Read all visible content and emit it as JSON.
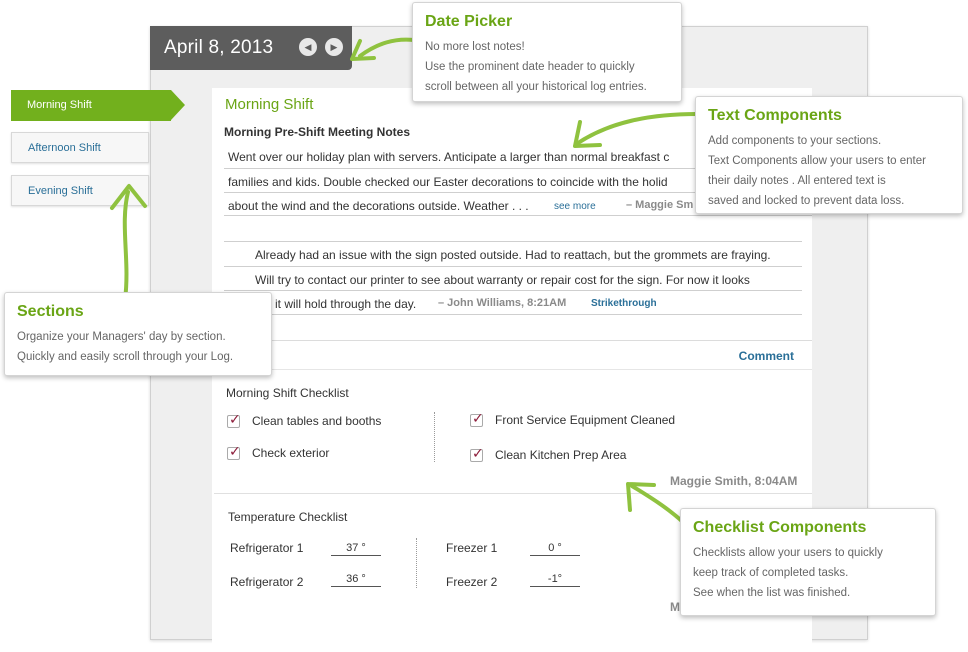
{
  "date_header": {
    "date": "April 8, 2013",
    "prev_icon": "◀",
    "next_icon": "▶"
  },
  "sections": [
    {
      "label": "Morning Shift"
    },
    {
      "label": "Afternoon Shift"
    },
    {
      "label": "Evening Shift"
    }
  ],
  "section_title": "Morning Shift",
  "notes": {
    "heading": "Morning Pre-Shift Meeting Notes",
    "lines": [
      "Went over our holiday plan with servers. Anticipate a larger than normal breakfast c",
      "families and kids. Double checked our Easter decorations to coincide with the holid",
      "about the wind and the decorations outside. Weather  . . ."
    ],
    "see_more": "see more",
    "author_partial": "– Maggie Sm"
  },
  "entry2": {
    "lines": [
      "Already had an issue with the sign posted outside. Had to reattach, but the grommets are fraying.",
      "Will try to contact our printer to see about warranty or repair cost for the sign. For now it looks",
      "e it will hold through the day."
    ],
    "author": "– John Williams, 8:21AM",
    "strikethrough": "Strikethrough"
  },
  "comment_button": "Comment",
  "checklist": {
    "title": "Morning Shift Checklist",
    "items": [
      {
        "label": "Clean tables and booths",
        "checked": true
      },
      {
        "label": "Check exterior",
        "checked": true
      },
      {
        "label": "Front Service Equipment Cleaned",
        "checked": true
      },
      {
        "label": "Clean Kitchen Prep Area",
        "checked": true
      }
    ],
    "signoff": "Maggie Smith, 8:04AM"
  },
  "temperature": {
    "title": "Temperature Checklist",
    "rows": [
      {
        "label": "Refrigerator 1",
        "value": "37 °"
      },
      {
        "label": "Refrigerator 2",
        "value": "36 °"
      },
      {
        "label": "Freezer 1",
        "value": "0 °"
      },
      {
        "label": "Freezer 2",
        "value": "-1°"
      }
    ],
    "signoff_partial": "M"
  },
  "callouts": {
    "date_picker": {
      "title": "Date Picker",
      "lines": [
        "No more lost notes!",
        "Use the prominent date header to quickly",
        "scroll between all your historical log entries."
      ]
    },
    "text_components": {
      "title": "Text Components",
      "lines": [
        "Add components to your sections.",
        "Text Components allow your users to enter",
        "their daily notes . All entered text is",
        "saved and locked to prevent data loss."
      ]
    },
    "sections": {
      "title": "Sections",
      "lines": [
        "Organize your Managers' day by section.",
        "Quickly and easily scroll through your Log."
      ]
    },
    "checklist_components": {
      "title": "Checklist Components",
      "lines": [
        "Checklists allow your users to quickly",
        "keep track of completed tasks.",
        "See when the list was finished."
      ]
    }
  },
  "colors": {
    "accent_green": "#72b01d",
    "header_gray": "#5d5d5d",
    "link_blue": "#2a6f98",
    "check_maroon": "#8c1c3a"
  }
}
